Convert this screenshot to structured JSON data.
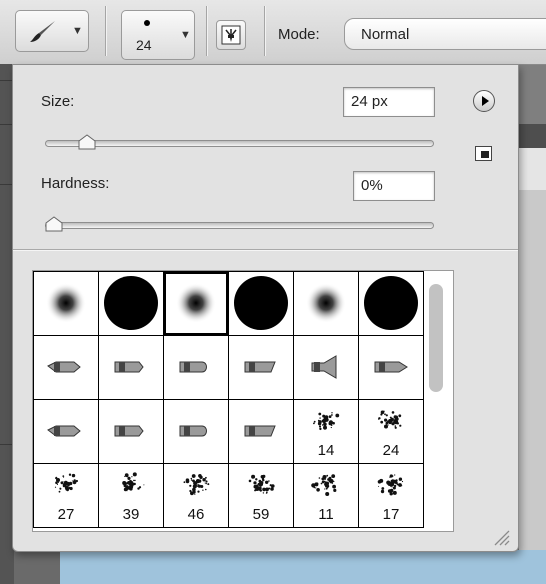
{
  "options_bar": {
    "tool_preset_icon": "brush-icon",
    "brush_size": "24",
    "toggle_panel_icon": "brush-panel-icon",
    "mode_label": "Mode:",
    "mode_value": "Normal"
  },
  "brush_popover": {
    "size_label": "Size:",
    "size_value": "24 px",
    "size_slider_fraction": 0.09,
    "hardness_label": "Hardness:",
    "hardness_value": "0%",
    "hardness_slider_fraction": 0.0,
    "menu_icon": "flyout-menu-icon",
    "new_preset_icon": "new-preset-icon",
    "presets": [
      {
        "kind": "soft",
        "label": ""
      },
      {
        "kind": "hard",
        "label": ""
      },
      {
        "kind": "soft",
        "label": "",
        "selected": true
      },
      {
        "kind": "hard",
        "label": ""
      },
      {
        "kind": "soft",
        "label": ""
      },
      {
        "kind": "hard",
        "label": ""
      },
      {
        "kind": "tool",
        "label": ""
      },
      {
        "kind": "tool",
        "label": ""
      },
      {
        "kind": "tool",
        "label": ""
      },
      {
        "kind": "tool",
        "label": ""
      },
      {
        "kind": "tool",
        "label": ""
      },
      {
        "kind": "tool",
        "label": ""
      },
      {
        "kind": "tool",
        "label": ""
      },
      {
        "kind": "tool",
        "label": ""
      },
      {
        "kind": "tool",
        "label": ""
      },
      {
        "kind": "tool",
        "label": ""
      },
      {
        "kind": "splatter",
        "label": "14"
      },
      {
        "kind": "splatter",
        "label": "24"
      },
      {
        "kind": "splatter",
        "label": "27"
      },
      {
        "kind": "splatter",
        "label": "39"
      },
      {
        "kind": "splatter",
        "label": "46"
      },
      {
        "kind": "splatter",
        "label": "59"
      },
      {
        "kind": "splatter",
        "label": "11"
      },
      {
        "kind": "splatter",
        "label": "17"
      }
    ]
  }
}
